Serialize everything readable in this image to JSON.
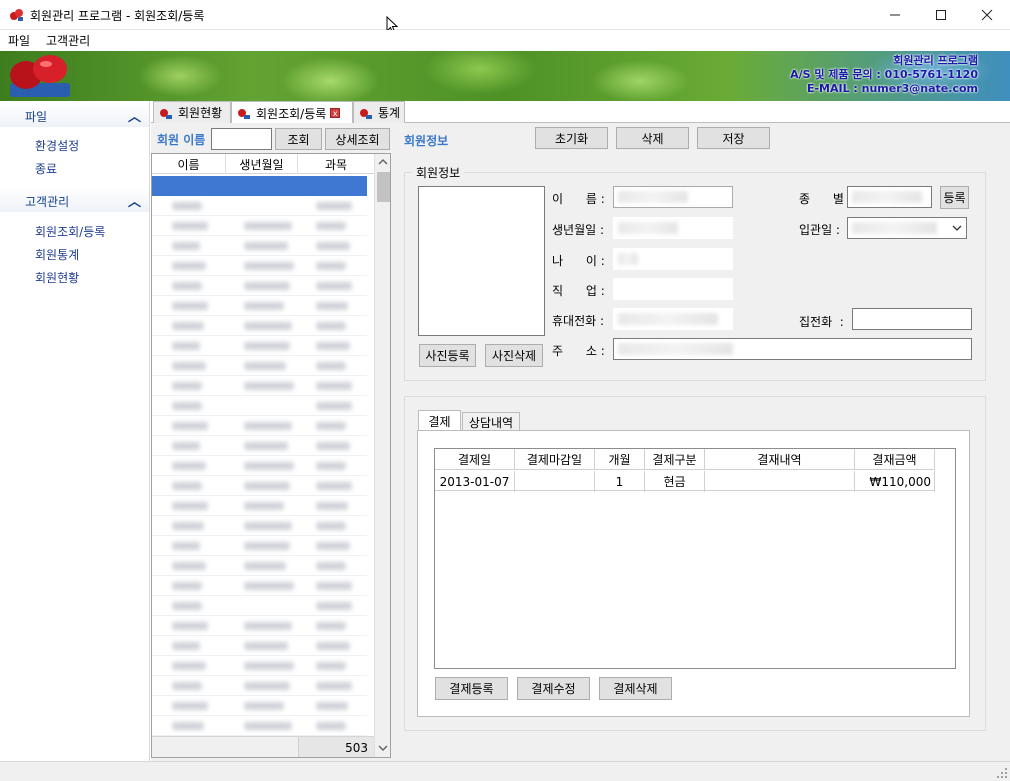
{
  "window": {
    "title": "회원관리 프로그램 - 회원조회/등록"
  },
  "menu": {
    "file": "파일",
    "customer": "고객관리"
  },
  "banner": {
    "line1": "회원관리 프로그램",
    "line2": "A/S 및 제품 문의 : 010-5761-1120",
    "line3": "E-MAIL : numer3@nate.com"
  },
  "sidebar": {
    "groups": [
      {
        "title": "파일",
        "items": [
          "환경설정",
          "종료"
        ]
      },
      {
        "title": "고객관리",
        "items": [
          "회원조회/등록",
          "회원통계",
          "회원현황"
        ]
      }
    ]
  },
  "tabs": [
    "회원현황",
    "회원조회/등록",
    "통계"
  ],
  "tab_close_glyph": "x",
  "search": {
    "label": "회원 이름",
    "value": "",
    "search_button": "조회",
    "detail_button": "상세조회",
    "section_label": "회원정보"
  },
  "actions": {
    "reset": "초기화",
    "delete": "삭제",
    "save": "저장"
  },
  "member_list": {
    "columns": [
      "이름",
      "생년월일",
      "과목"
    ],
    "count": "503"
  },
  "member_info": {
    "group_title": "회원정보",
    "photo_register": "사진등록",
    "photo_delete": "사진삭제",
    "fields": {
      "name": "이      름 :",
      "birth": "생년월일 :",
      "age": "나      이 :",
      "job": "직      업 :",
      "mobile": "휴대전화 :",
      "address": "주      소 :",
      "type": "종      별 :",
      "join_date": "입관일 :",
      "home_phone": "집전화  :"
    },
    "register_button": "등록"
  },
  "payment": {
    "tabs": [
      "결제",
      "상담내역"
    ],
    "columns": [
      "결제일",
      "결제마감일",
      "개월",
      "결제구분",
      "결재내역",
      "결재금액"
    ],
    "rows": [
      {
        "date": "2013-01-07",
        "due": "",
        "months": "1",
        "method": "현금",
        "detail": "",
        "amount": "₩110,000"
      }
    ],
    "buttons": {
      "add": "결제등록",
      "edit": "결제수정",
      "delete": "결제삭제"
    }
  },
  "colors": {
    "accent": "#3a78c8",
    "selection": "#3e78d2",
    "link": "#1e3d8f"
  }
}
